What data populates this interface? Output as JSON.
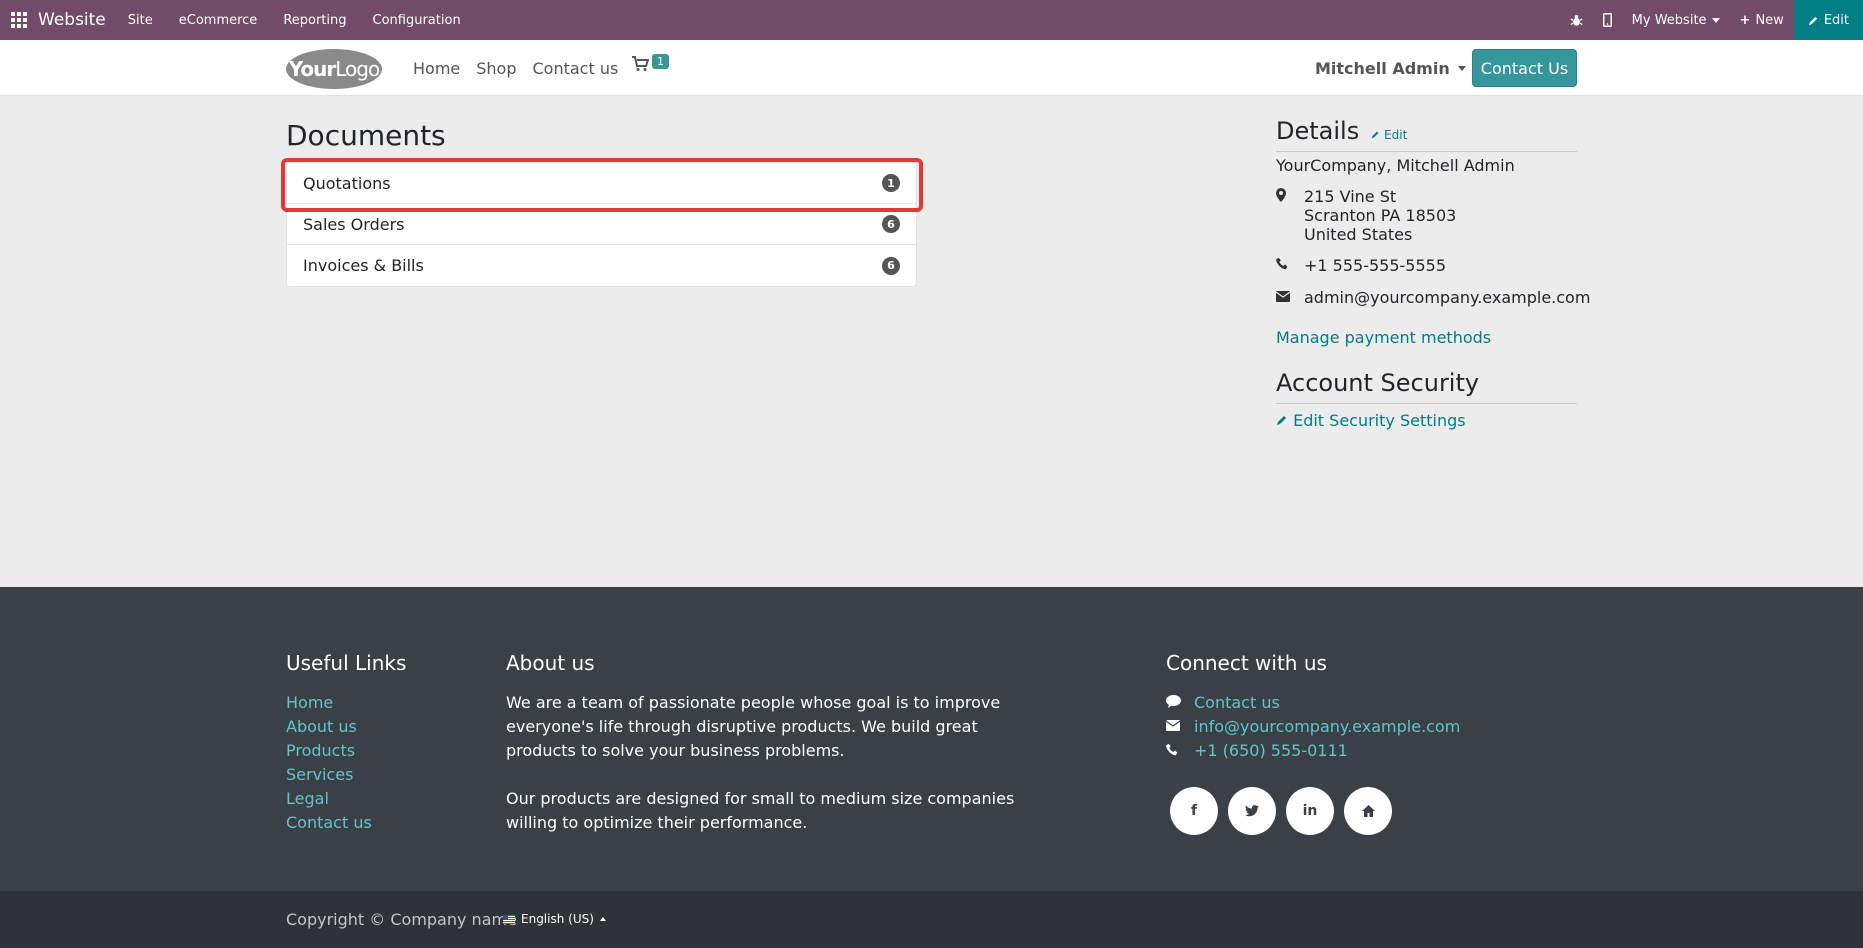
{
  "admin_bar": {
    "brand": "Website",
    "menu": [
      "Site",
      "eCommerce",
      "Reporting",
      "Configuration"
    ],
    "website_selector": "My Website",
    "new_label": "New",
    "edit_label": "Edit",
    "bg_color": "#714b67"
  },
  "header": {
    "logo_text_bold": "Your",
    "logo_text": "Logo",
    "nav": [
      "Home",
      "Shop",
      "Contact us"
    ],
    "cart_count": "1",
    "user": "Mitchell Admin",
    "contact_button": "Contact Us"
  },
  "documents": {
    "title": "Documents",
    "items": [
      {
        "label": "Quotations",
        "count": "1"
      },
      {
        "label": "Sales Orders",
        "count": "6"
      },
      {
        "label": "Invoices & Bills",
        "count": "6"
      }
    ]
  },
  "details": {
    "title": "Details",
    "edit_label": "Edit",
    "name": "YourCompany, Mitchell Admin",
    "address": [
      "215 Vine St",
      "Scranton PA 18503",
      "United States"
    ],
    "phone": "+1 555-555-5555",
    "email": "admin@yourcompany.example.com",
    "manage_payment": "Manage payment methods",
    "security_title": "Account Security",
    "security_link": "Edit Security Settings"
  },
  "footer": {
    "useful_links_title": "Useful Links",
    "useful_links": [
      "Home",
      "About us",
      "Products",
      "Services",
      "Legal",
      "Contact us"
    ],
    "about_title": "About us",
    "about_p1": "We are a team of passionate people whose goal is to improve everyone's life through disruptive products. We build great products to solve your business problems.",
    "about_p2": "Our products are designed for small to medium size companies willing to optimize their performance.",
    "connect_title": "Connect with us",
    "connect_contact": "Contact us",
    "connect_email": "info@yourcompany.example.com",
    "connect_phone": "+1 (650) 555-0111",
    "social": [
      "f",
      "t",
      "in",
      "home"
    ],
    "copyright": "Copyright © Company name",
    "language": "English (US)"
  },
  "colors": {
    "primary": "#35979c",
    "link": "#017e84",
    "highlight": "#dc3b36",
    "footer_bg": "#3b3f46"
  }
}
